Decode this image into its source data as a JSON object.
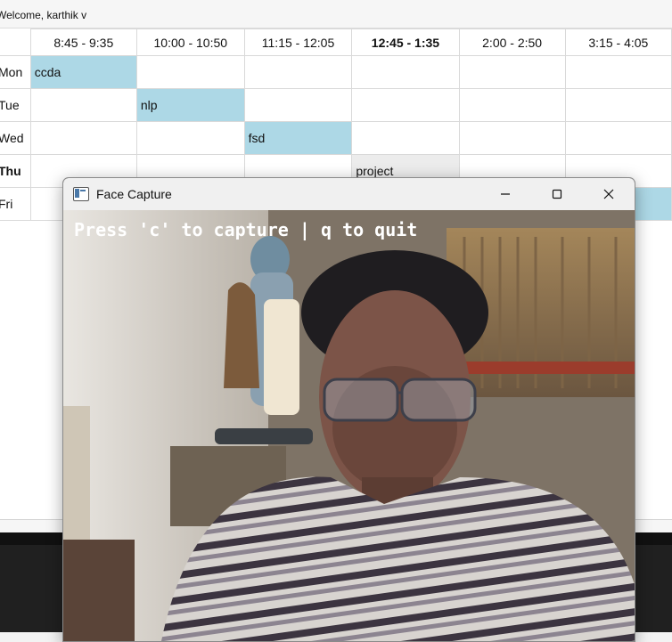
{
  "header": {
    "welcome": "Welcome, karthik v"
  },
  "timetable": {
    "slots": [
      "8:45 - 9:35",
      "10:00 - 10:50",
      "11:15 - 12:05",
      "12:45 - 1:35",
      "2:00 - 2:50",
      "3:15 - 4:05"
    ],
    "days": [
      "Mon",
      "Tue",
      "Wed",
      "Thu",
      "Fri"
    ],
    "entries": {
      "mon_0": "ccda",
      "tue_1": "nlp",
      "wed_2": "fsd",
      "thu_3": "project"
    },
    "colors": {
      "filled": "#add8e6",
      "current": "#ececec"
    }
  },
  "capture_window": {
    "title": "Face Capture",
    "overlay": "Press 'c' to capture | q to quit",
    "icons": {
      "app": "app-window-icon",
      "minimize": "minimize-icon",
      "maximize": "maximize-icon",
      "close": "close-icon"
    }
  }
}
